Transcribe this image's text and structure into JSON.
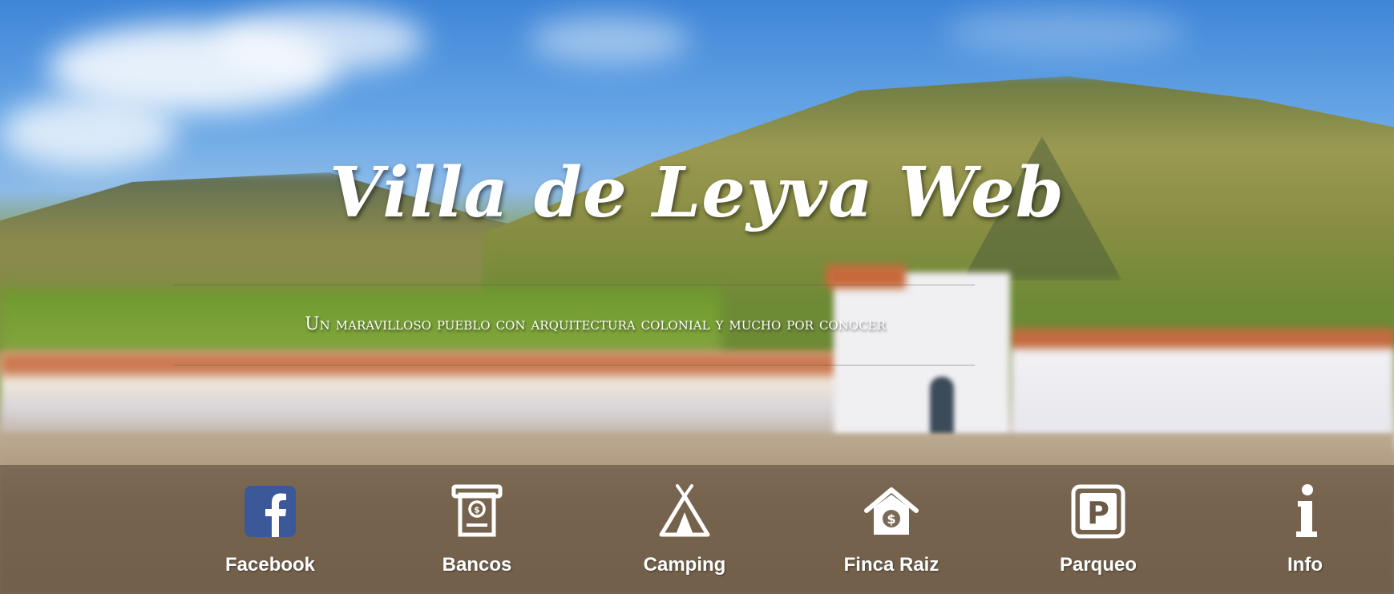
{
  "hero": {
    "title": "Villa de Leyva Web",
    "subtitle": "Un maravilloso pueblo con arquitectura colonial y mucho por conocer"
  },
  "nav": {
    "items": [
      {
        "label": "Facebook",
        "icon": "facebook-icon"
      },
      {
        "label": "Bancos",
        "icon": "atm-icon"
      },
      {
        "label": "Camping",
        "icon": "tent-icon"
      },
      {
        "label": "Finca Raiz",
        "icon": "house-dollar-icon"
      },
      {
        "label": "Parqueo",
        "icon": "parking-icon"
      },
      {
        "label": "Info",
        "icon": "info-icon"
      }
    ]
  },
  "colors": {
    "facebook_blue": "#3b5998",
    "nav_bar": "#50413299",
    "text": "#ffffff"
  }
}
